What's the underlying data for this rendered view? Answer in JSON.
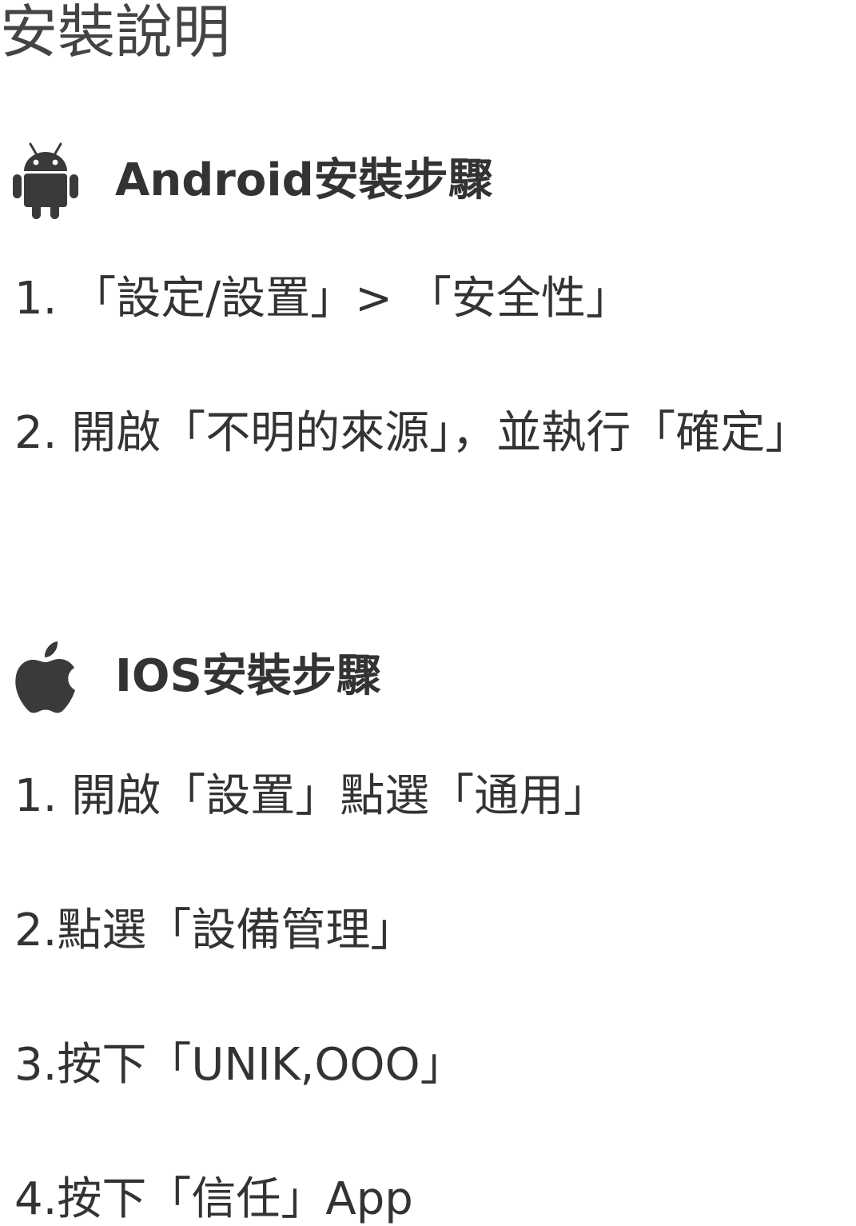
{
  "page": {
    "title": "安裝說明"
  },
  "android": {
    "icon": "android-icon",
    "title": "Android安裝步驟",
    "steps": [
      "1. 「設定/設置」> 「安全性」",
      "2. 開啟「不明的來源」，並執行「確定」"
    ]
  },
  "ios": {
    "icon": "apple-icon",
    "title": "IOS安裝步驟",
    "steps": [
      "1. 開啟「設置」點選「通用」",
      "2.點選「設備管理」",
      "3.按下「UNIK,OOO」",
      "4.按下「信任」App"
    ]
  },
  "colors": {
    "text": "#333333",
    "icon": "#3a3a3a",
    "background": "#ffffff"
  }
}
